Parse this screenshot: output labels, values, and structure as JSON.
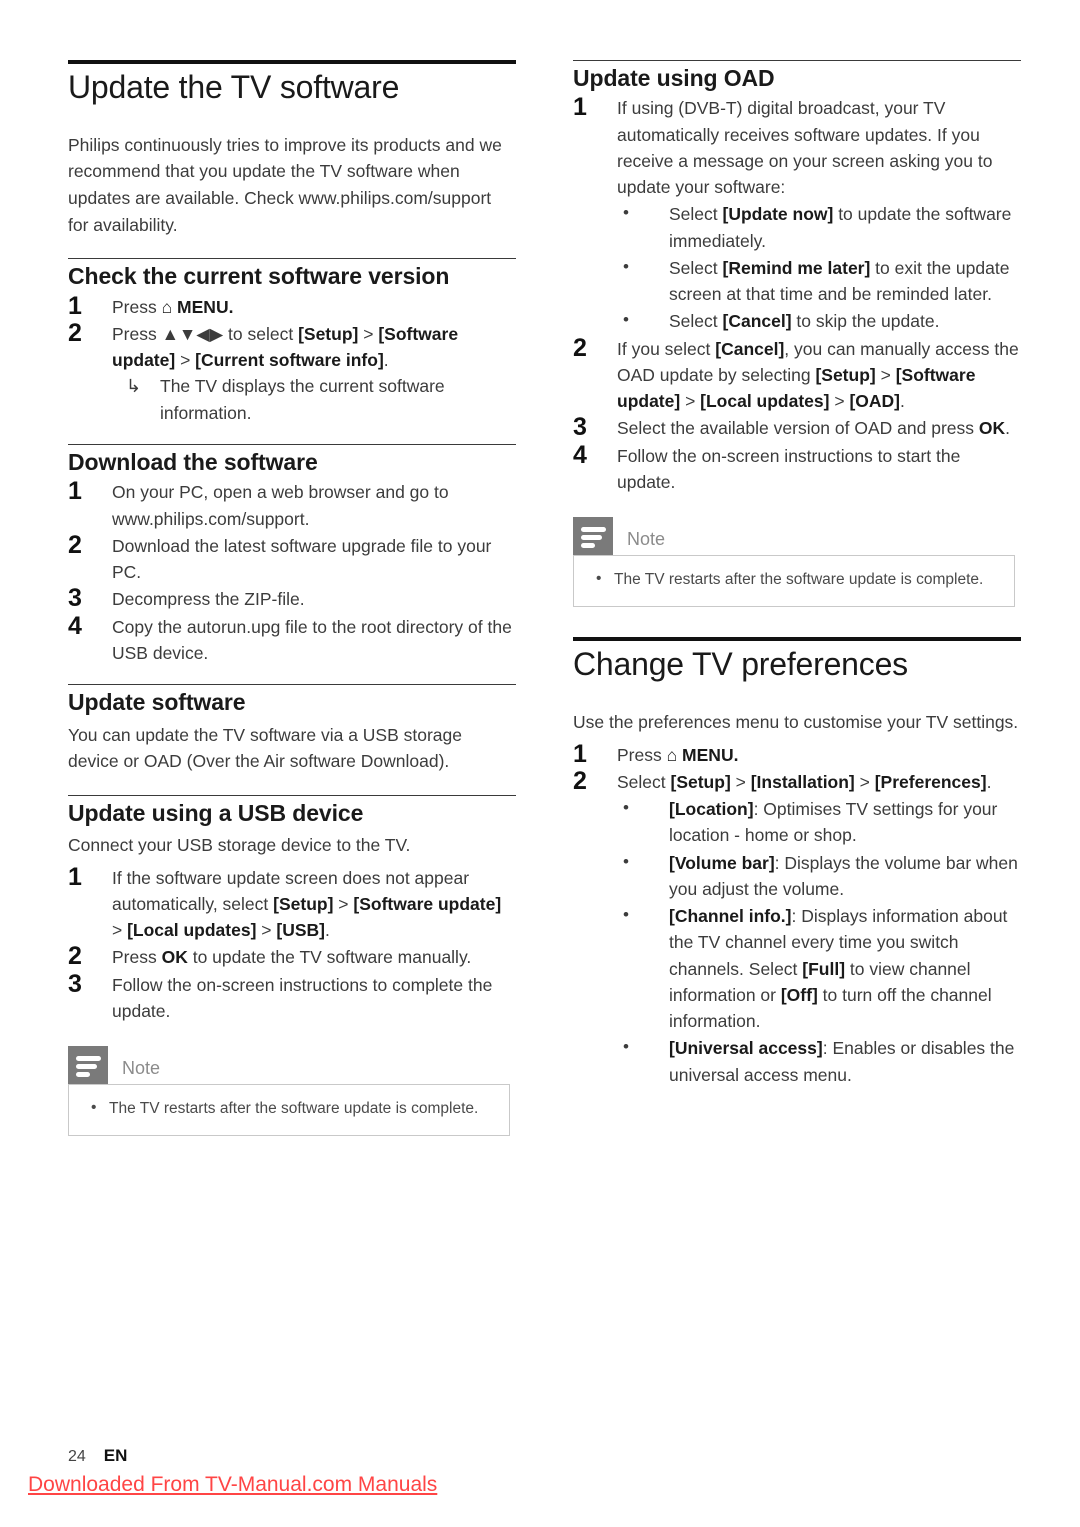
{
  "page": {
    "number": "24",
    "language": "EN",
    "watermark": "Downloaded From TV-Manual.com Manuals"
  },
  "glyphs": {
    "home": "⌂",
    "nav_arrows": "▲▼◀▶",
    "result_arrow": "↳",
    "bullet": "•",
    "gt": ">"
  },
  "left_column": {
    "chapter_title": "Update the TV software",
    "intro": "Philips continuously tries to improve its products and we recommend that you update the TV software when updates are available. Check www.philips.com/support for availability.",
    "sections": [
      {
        "heading": "Check the current software version",
        "steps": [
          {
            "num": "1",
            "prefix": "Press ",
            "icon": "home",
            "suffix": " MENU."
          },
          {
            "num": "2",
            "parts": [
              {
                "t": "Press ",
                "b": false
              },
              {
                "t": "▲▼◀▶",
                "b": false
              },
              {
                "t": " to select ",
                "b": false
              },
              {
                "t": "[Setup]",
                "b": true
              },
              {
                "t": " > ",
                "b": false
              },
              {
                "t": "[Software update]",
                "b": true
              },
              {
                "t": " > ",
                "b": false
              },
              {
                "t": "[Current software info]",
                "b": true
              },
              {
                "t": ".",
                "b": false
              }
            ],
            "result": "The TV displays the current software information."
          }
        ]
      },
      {
        "heading": "Download the software",
        "steps": [
          {
            "num": "1",
            "text": "On your PC, open a web browser and go to www.philips.com/support."
          },
          {
            "num": "2",
            "text": "Download the latest software upgrade file to your PC."
          },
          {
            "num": "3",
            "text": "Decompress the ZIP-file."
          },
          {
            "num": "4",
            "text": "Copy the autorun.upg file to the root directory of the USB device."
          }
        ]
      },
      {
        "heading": "Update software",
        "intro": "You can update the TV software via a USB storage device or OAD (Over the Air software Download)."
      },
      {
        "heading": "Update using a USB device",
        "intro": "Connect your USB storage device to the TV.",
        "steps": [
          {
            "num": "1",
            "parts": [
              {
                "t": "If the software update screen does not appear automatically, select ",
                "b": false
              },
              {
                "t": "[Setup]",
                "b": true
              },
              {
                "t": " > ",
                "b": false
              },
              {
                "t": "[Software update]",
                "b": true
              },
              {
                "t": " > ",
                "b": false
              },
              {
                "t": "[Local updates]",
                "b": true
              },
              {
                "t": " > ",
                "b": false
              },
              {
                "t": "[USB]",
                "b": true
              },
              {
                "t": ".",
                "b": false
              }
            ]
          },
          {
            "num": "2",
            "parts": [
              {
                "t": "Press ",
                "b": false
              },
              {
                "t": "OK",
                "b": true
              },
              {
                "t": " to update the TV software manually.",
                "b": false
              }
            ]
          },
          {
            "num": "3",
            "text": "Follow the on-screen instructions to complete the update."
          }
        ]
      }
    ],
    "note": {
      "title": "Note",
      "items": [
        "The TV restarts after the software update is complete."
      ]
    }
  },
  "right_column": {
    "sections": [
      {
        "heading": "Update using OAD",
        "steps": [
          {
            "num": "1",
            "text": "If using (DVB-T) digital broadcast, your TV automatically receives software updates. If you receive a message on your screen asking you to update your software:",
            "bullets": [
              [
                {
                  "t": "Select ",
                  "b": false
                },
                {
                  "t": "[Update now]",
                  "b": true
                },
                {
                  "t": " to update the software immediately.",
                  "b": false
                }
              ],
              [
                {
                  "t": "Select ",
                  "b": false
                },
                {
                  "t": "[Remind me later]",
                  "b": true
                },
                {
                  "t": " to exit the update screen at that time and be reminded later.",
                  "b": false
                }
              ],
              [
                {
                  "t": "Select ",
                  "b": false
                },
                {
                  "t": "[Cancel]",
                  "b": true
                },
                {
                  "t": " to skip the update.",
                  "b": false
                }
              ]
            ]
          },
          {
            "num": "2",
            "parts": [
              {
                "t": "If you select ",
                "b": false
              },
              {
                "t": "[Cancel]",
                "b": true
              },
              {
                "t": ", you can manually access the OAD update by selecting ",
                "b": false
              },
              {
                "t": "[Setup]",
                "b": true
              },
              {
                "t": " > ",
                "b": false
              },
              {
                "t": "[Software update]",
                "b": true
              },
              {
                "t": " > ",
                "b": false
              },
              {
                "t": "[Local updates]",
                "b": true
              },
              {
                "t": " > ",
                "b": false
              },
              {
                "t": "[OAD]",
                "b": true
              },
              {
                "t": ".",
                "b": false
              }
            ]
          },
          {
            "num": "3",
            "parts": [
              {
                "t": "Select the available version of OAD and press ",
                "b": false
              },
              {
                "t": "OK",
                "b": true
              },
              {
                "t": ".",
                "b": false
              }
            ]
          },
          {
            "num": "4",
            "text": "Follow the on-screen instructions to start the update."
          }
        ],
        "note": {
          "title": "Note",
          "items": [
            "The TV restarts after the software update is complete."
          ]
        }
      }
    ],
    "chapter_title": "Change TV preferences",
    "intro": "Use the preferences menu to customise your TV settings.",
    "pref_steps": [
      {
        "num": "1",
        "prefix": "Press ",
        "icon": "home",
        "suffix": " MENU."
      },
      {
        "num": "2",
        "parts": [
          {
            "t": "Select ",
            "b": false
          },
          {
            "t": "[Setup]",
            "b": true
          },
          {
            "t": " > ",
            "b": false
          },
          {
            "t": "[Installation]",
            "b": true
          },
          {
            "t": " > ",
            "b": false
          },
          {
            "t": "[Preferences]",
            "b": true
          },
          {
            "t": ".",
            "b": false
          }
        ],
        "bullets": [
          [
            {
              "t": "[Location]",
              "b": true
            },
            {
              "t": ": Optimises TV settings for your location - home or shop.",
              "b": false
            }
          ],
          [
            {
              "t": "[Volume bar]",
              "b": true
            },
            {
              "t": ": Displays the volume bar when you adjust the volume.",
              "b": false
            }
          ],
          [
            {
              "t": "[Channel info.]",
              "b": true
            },
            {
              "t": ": Displays information about the TV channel every time you switch channels. Select ",
              "b": false
            },
            {
              "t": "[Full]",
              "b": true
            },
            {
              "t": " to view channel information or ",
              "b": false
            },
            {
              "t": "[Off]",
              "b": true
            },
            {
              "t": " to turn off the channel information.",
              "b": false
            }
          ],
          [
            {
              "t": "[Universal access]",
              "b": true
            },
            {
              "t": ": Enables or disables the universal access menu.",
              "b": false
            }
          ]
        ]
      }
    ]
  }
}
